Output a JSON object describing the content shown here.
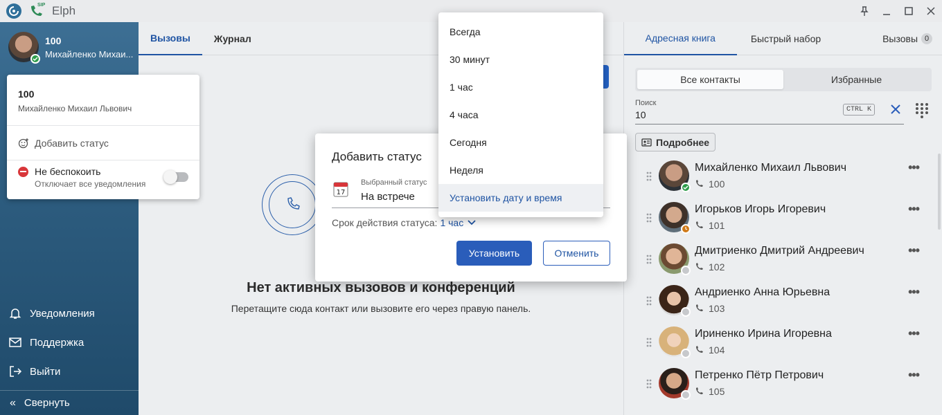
{
  "window": {
    "title": "Elph",
    "sip_label": "SIP"
  },
  "me": {
    "ext": "100",
    "name_short": "Михайленко Михаи...",
    "presence_color": "#2e9c4b"
  },
  "status_popover": {
    "ext": "100",
    "name": "Михайленко Михаил Львович",
    "add_status": "Добавить статус",
    "dnd_title": "Не беспокоить",
    "dnd_subtitle": "Отключает все уведомления",
    "dnd_enabled": false
  },
  "sidebar": {
    "items": [
      {
        "label": "Уведомления",
        "icon": "bell-icon"
      },
      {
        "label": "Поддержка",
        "icon": "mail-icon"
      },
      {
        "label": "Выйти",
        "icon": "logout-icon"
      }
    ],
    "collapse_label": "Свернуть"
  },
  "center": {
    "tabs": [
      "Вызовы",
      "Журнал"
    ],
    "empty_title": "Нет активных вызовов и конференций",
    "empty_subtitle": "Перетащите сюда контакт или вызовите его через правую панель."
  },
  "modal": {
    "title": "Добавить статус",
    "selected_label": "Выбранный статус",
    "selected_value": "На встрече",
    "duration_label": "Срок действия статуса:",
    "duration_value": "1 час",
    "ok_label": "Установить",
    "cancel_label": "Отменить",
    "calendar_day": "17"
  },
  "dropdown": {
    "options": [
      "Всегда",
      "30 минут",
      "1 час",
      "4 часа",
      "Сегодня",
      "Неделя",
      "Установить дату и время"
    ],
    "highlighted_index": 6
  },
  "right": {
    "tabs": [
      {
        "label": "Адресная книга"
      },
      {
        "label": "Быстрый набор"
      },
      {
        "label": "Вызовы",
        "badge": "0"
      }
    ],
    "segments": [
      "Все контакты",
      "Избранные"
    ],
    "search": {
      "label": "Поиск",
      "value": "10",
      "shortcut": "CTRL K"
    },
    "more_label": "Подробнее",
    "contacts": [
      {
        "name": "Михайленко Михаил Львович",
        "ext": "100",
        "presence": "online"
      },
      {
        "name": "Игорьков Игорь Игоревич",
        "ext": "101",
        "presence": "away"
      },
      {
        "name": "Дмитриенко Дмитрий Андреевич",
        "ext": "102",
        "presence": "offline"
      },
      {
        "name": "Андриенко Анна Юрьевна",
        "ext": "103",
        "presence": "offline"
      },
      {
        "name": "Ириненко Ирина Игоревна",
        "ext": "104",
        "presence": "offline"
      },
      {
        "name": "Петренко Пётр Петрович",
        "ext": "105",
        "presence": "offline"
      }
    ]
  },
  "colors": {
    "accent": "#1f54a3",
    "primary_button": "#2a5dba",
    "online": "#2e9c4b",
    "away": "#d07a18",
    "dnd": "#d8363a"
  }
}
